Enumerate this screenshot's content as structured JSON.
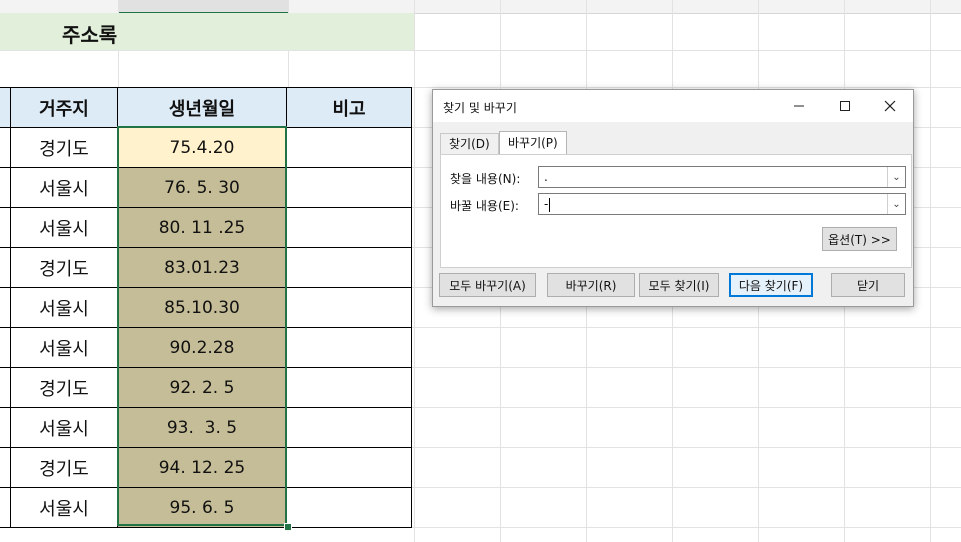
{
  "sheet": {
    "title": "주소록",
    "headers": [
      "거주지",
      "생년월일",
      "비고"
    ],
    "rows": [
      {
        "region": "경기도",
        "birth": "75.4.20",
        "note": ""
      },
      {
        "region": "서울시",
        "birth": "76. 5. 30",
        "note": ""
      },
      {
        "region": "서울시",
        "birth": "80. 11 .25",
        "note": ""
      },
      {
        "region": "경기도",
        "birth": "83.01.23",
        "note": ""
      },
      {
        "region": "서울시",
        "birth": "85.10.30",
        "note": ""
      },
      {
        "region": "서울시",
        "birth": "90.2.28",
        "note": ""
      },
      {
        "region": "경기도",
        "birth": "92. 2. 5",
        "note": ""
      },
      {
        "region": "서울시",
        "birth": "93.  3. 5",
        "note": ""
      },
      {
        "region": "경기도",
        "birth": "94. 12. 25",
        "note": ""
      },
      {
        "region": "서울시",
        "birth": "95. 6. 5",
        "note": ""
      }
    ],
    "colors": {
      "title_band": "#e2efda",
      "header_fill": "#ddebf7",
      "selected_fill": "#c4bd97",
      "active_cell": "#fff2cc",
      "selection_border": "#217346"
    }
  },
  "dialog": {
    "title": "찾기 및 바꾸기",
    "tabs": [
      "찾기(D)",
      "바꾸기(P)"
    ],
    "active_tab": "바꾸기(P)",
    "find_label": "찾을 내용(N):",
    "find_value": ".",
    "replace_label": "바꿀 내용(E):",
    "replace_value": "-",
    "options_button": "옵션(T) >>",
    "buttons": {
      "replace_all": "모두 바꾸기(A)",
      "replace": "바꾸기(R)",
      "find_all": "모두 찾기(I)",
      "find_next": "다음 찾기(F)",
      "close": "닫기"
    },
    "window_icons": [
      "minimize-icon",
      "maximize-icon",
      "close-icon"
    ]
  }
}
